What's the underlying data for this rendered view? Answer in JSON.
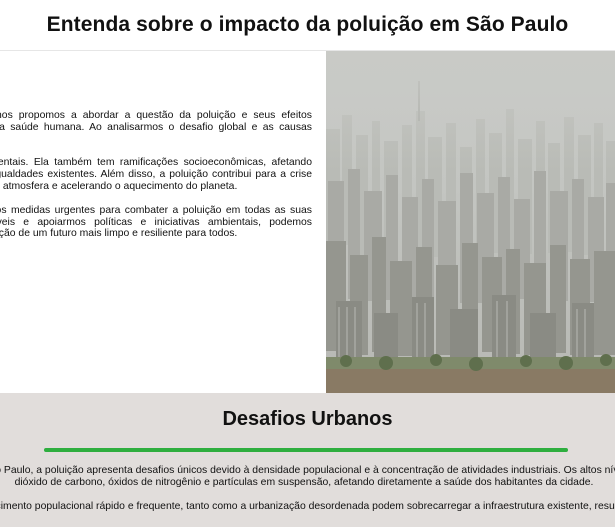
{
  "header": {
    "title": "Entenda sobre o impacto da poluição em São Paulo"
  },
  "intro": {
    "paragraphs": [
      "A cidade é centro de dimensões e nós nos propomos a abordar a questão da poluição e seus efeitos impactantes em nosso meio ambiente e na saúde humana. Ao analisarmos o desafio global e as causas subjacentes que o alimentam.",
      "A poluição não se limita a questões ambientais. Ela também tem ramificações socioeconômicas, afetando comunidades vulneráveis e ampliando desigualdades existentes. Além disso, a poluição contribui para a crise climática, liberando gases de efeito estufa na atmosfera e acelerando o aquecimento do planeta.",
      "Neste contexto, é fundamental que tomemos medidas urgentes para combater a poluição em todas as suas formas. Ao adotarmos práticas sustentáveis e apoiarmos políticas e iniciativas ambientais, podemos desempenhar um papel essencial na construção de um futuro mais limpo e resiliente para todos."
    ]
  },
  "image": {
    "alt": "São Paulo skyline",
    "sky_color": "#c9cbc8",
    "city_color": "#9ea09a"
  },
  "challenges": {
    "title": "Desafios Urbanos",
    "divider_color": "#2eae3f",
    "paragraphs": [
      "Em grandes cidades como São Paulo, a poluição apresenta desafios únicos devido à densidade populacional e à concentração de atividades industriais. Os altos níveis de poluentes no ar, como dióxido de carbono, óxidos de nitrogênio e partículas em suspensão, afetando diretamente a saúde dos habitantes da cidade.",
      "O crescimento populacional rápido e frequente, tanto como a urbanização desordenada podem sobrecarregar a infraestrutura existente, resultando"
    ]
  }
}
